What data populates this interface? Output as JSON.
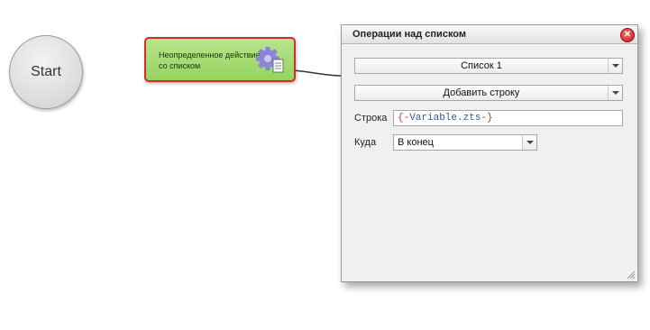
{
  "canvas": {
    "start_node": {
      "label": "Start"
    },
    "action_node": {
      "label": "Неопределенное действие со списком",
      "icon": "gear-document-icon",
      "border_color": "#d62a2a",
      "fill_color": "#a6dc74"
    }
  },
  "dialog": {
    "title": "Операции над списком",
    "list_select": {
      "value": "Список 1"
    },
    "operation_select": {
      "value": "Добавить строку"
    },
    "row_field": {
      "label": "Строка",
      "value": "{-Variable.zts-}",
      "value_parts": {
        "open": "{-",
        "var": "Variable.zts",
        "close": "-}"
      }
    },
    "where_field": {
      "label": "Куда",
      "value": "В конец"
    },
    "close_icon": "close-icon"
  }
}
